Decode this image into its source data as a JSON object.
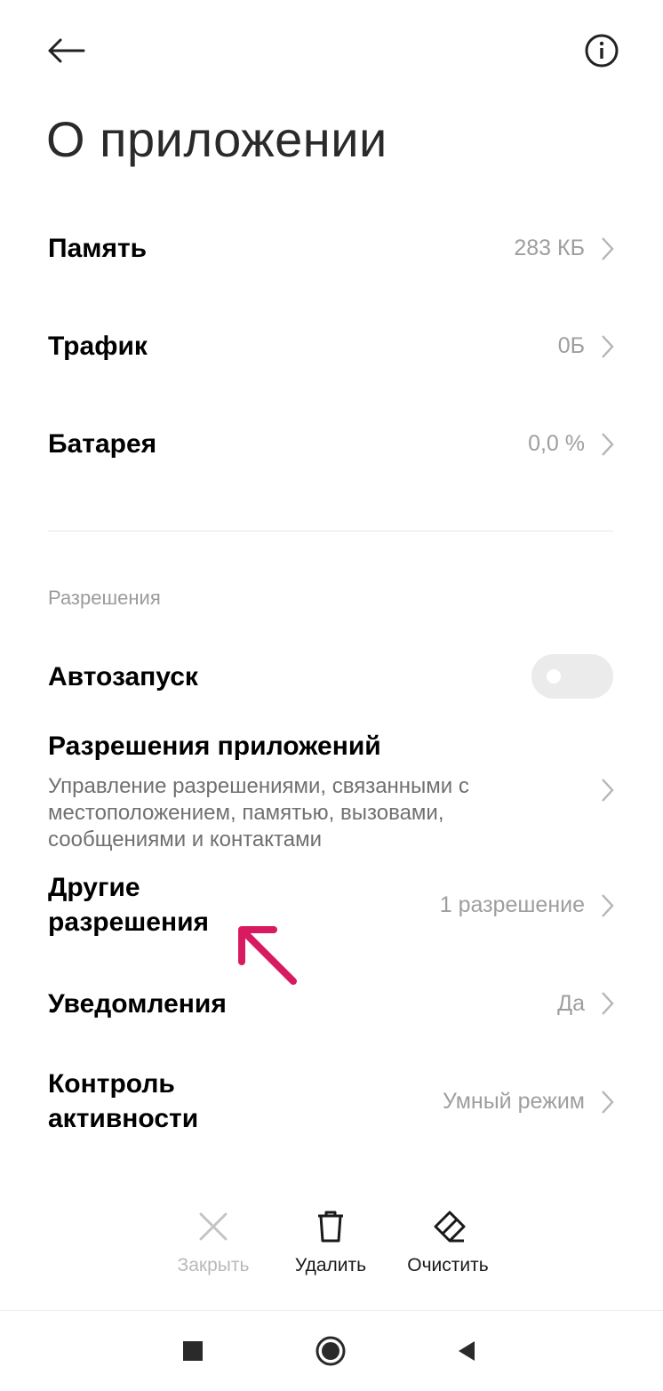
{
  "header": {
    "back_icon": "arrow-left-icon",
    "info_icon": "info-circle-icon"
  },
  "page": {
    "title": "О приложении"
  },
  "usage_rows": [
    {
      "label": "Память",
      "value": "283 КБ"
    },
    {
      "label": "Трафик",
      "value": "0Б"
    },
    {
      "label": "Батарея",
      "value": "0,0 %"
    }
  ],
  "permissions": {
    "section_title": "Разрешения",
    "autostart": {
      "label": "Автозапуск",
      "enabled": false
    },
    "app_permissions": {
      "label": "Разрешения приложений",
      "description": "Управление разрешениями, связанными с местоположением, памятью, вызовами, сообщениями и контактами"
    },
    "other_permissions": {
      "label_line1": "Другие",
      "label_line2": "разрешения",
      "value": "1 разрешение"
    },
    "notifications": {
      "label": "Уведомления",
      "value": "Да"
    },
    "activity_control": {
      "label_line1": "Контроль",
      "label_line2": "активности",
      "value": "Умный режим"
    }
  },
  "annotation": {
    "arrow_color": "#d81b60"
  },
  "actions": {
    "close": {
      "label": "Закрыть",
      "icon": "close-icon",
      "disabled": true
    },
    "delete": {
      "label": "Удалить",
      "icon": "trash-icon"
    },
    "clear": {
      "label": "Очистить",
      "icon": "eraser-icon"
    }
  },
  "navbar": {
    "recent_icon": "square-icon",
    "home_icon": "circle-icon",
    "back_icon": "triangle-back-icon"
  }
}
